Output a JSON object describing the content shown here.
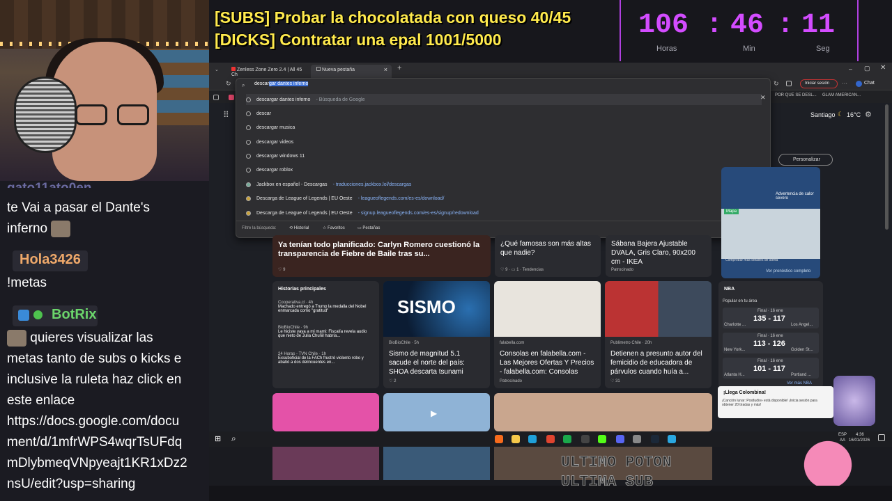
{
  "overlay": {
    "goal_subs": "[SUBS] Probar la chocolatada con queso 40/45",
    "goal_kicks": "[DICKS] Contratar una epal 1001/5000",
    "timer": {
      "hours": "106",
      "minutes": "46",
      "seconds": "11",
      "sep": ":",
      "hours_label": "Horas",
      "minutes_label": "Min",
      "seconds_label": "Seg"
    },
    "accent": "#d34cff",
    "goal_color": "#ffea4d"
  },
  "chat": {
    "partial_user": "gato11ato0en",
    "msg1_line1": "te Vai a pasar el Dante's",
    "msg1_line2": "inferno",
    "user2": "Hola3426",
    "user2_color": "#f0a96a",
    "msg2": "!metas",
    "bot": "BotRix",
    "bot_color": "#6bd56b",
    "bot_lines": [
      "quieres visualizar las",
      "metas tanto de subs o kicks e",
      "inclusive la ruleta haz click en",
      "este enlace",
      "https://docs.google.com/docu",
      "ment/d/1mfrWPS4wqrTsUFdq",
      "mDlybmeqVNpyeajt1KR1xDz2",
      "nsU/edit?usp=sharing"
    ]
  },
  "browser": {
    "tabs": [
      {
        "label": "Zenless Zone Zero 2.4 | All 45 Ch"
      },
      {
        "label": "Nueva pestaña"
      }
    ],
    "address_typed": "descar",
    "address_selected": "gar dantes inferno",
    "signin": "Iniciar sesión",
    "chat": "Chat",
    "fav1": "POR QUE SE DESL...",
    "fav2": "GLAM AMERICAN...",
    "suggestions": [
      {
        "text": "descargar dantes inferno",
        "meta": "- Búsqueda de Google"
      },
      {
        "text": "descar",
        "meta": ""
      },
      {
        "text": "descargar musica",
        "meta": ""
      },
      {
        "text": "descargar videos",
        "meta": ""
      },
      {
        "text": "descargar windows 11",
        "meta": ""
      },
      {
        "text": "descargar roblox",
        "meta": ""
      },
      {
        "text": "Jackbox en español - Descargas",
        "meta": "- traducciones.jackbox.lol/descargas"
      },
      {
        "text": "Descarga de League of Legends | EU Oeste",
        "meta": "- leagueoflegends.com/es-es/download/"
      },
      {
        "text": "Descarga de League of Legends | EU Oeste",
        "meta": "- signup.leagueoflegends.com/es-es/signup/redownload"
      }
    ],
    "filter_label": "Filtre la búsqueda:",
    "filter_history": "Historial",
    "filter_favorites": "Favoritos",
    "filter_tabs": "Pestañas"
  },
  "feed": {
    "weather": {
      "city": "Santiago",
      "temp": "16°C",
      "alert": "Advertencia de calor severo",
      "map": "Mapa",
      "more": "Comprobar más detalles de alerta",
      "forecast": "Ver pronóstico completo",
      "customize": "Personalizar"
    },
    "headline_main": "Ya tenían todo planificado: Carlyn Romero cuestionó la transparencia de Fiebre de Baile tras su...",
    "headline_main_likes": "9",
    "card_famous": "¿Qué famosas son más altas que nadie?",
    "card_famous_likes": "9",
    "card_famous_comments": "1",
    "card_famous_tag": "Tendencias",
    "card_ikea": "Sábana Bajera Ajustable DVALA, Gris Claro, 90x200 cm - IKEA",
    "card_ikea_sponsor": "Patrocinado",
    "top_stories": "Historias principales",
    "stories": [
      {
        "src": "Cooperativa.cl · 4h",
        "text": "Machado entregó a Trump la medalla del Nobel enmarcada como \"gratitud\""
      },
      {
        "src": "BioBioChile · 9h",
        "text": "Le hiciste yaya a mi mami: Fiscalía revela audio que nieto de Julia Chuñil habría..."
      },
      {
        "src": "24 Horas - TVN Chile · 1h",
        "text": "Exsuboficial de la FACh frustró violento robo y abatió a dos delincuentes en..."
      }
    ],
    "sismo_img": "SISMO",
    "sismo_src": "BioBioChile · 5h",
    "sismo_title": "Sismo de magnitud 5.1 sacude el norte del país: SHOA descarta tsunami",
    "sismo_likes": "2",
    "falabella_src": "falabella.com",
    "falabella_title": "Consolas en falabella.com - Las Mejores Ofertas Y Precios - falabella.com: Consolas",
    "falabella_sponsor": "Patrocinado",
    "crime_src": "Publimetro Chile · 20h",
    "crime_title": "Detienen a presunto autor del femicidio de educadora de párvulos cuando huía a...",
    "crime_likes": "31",
    "nba": "NBA",
    "nba_sub": "Popular en tu área",
    "games": [
      {
        "home": "Charlotte ...",
        "away": "Los Angel...",
        "score": "135 - 117",
        "status": "Final · 16 ene"
      },
      {
        "home": "New York...",
        "away": "Golden St...",
        "score": "113 - 126",
        "status": "Final · 16 ene"
      },
      {
        "home": "Atlanta H...",
        "away": "Portland ...",
        "score": "101 - 117",
        "status": "Final · 16 ene"
      }
    ],
    "nba_more": "Ver más NBA",
    "notif_title": "¡Llega Colombina!",
    "notif_text": "¡Canción lunar: Postludio» está disponible! ¡Inicia sesión para obtener 20 tiradas y más!"
  },
  "taskbar": {
    "lang": "ESP",
    "lang2": "AA",
    "time": "4:36",
    "date": "16/01/2026"
  },
  "stream_overlay": {
    "line1": "ULTIMO POTON",
    "line2": "ULTIMA SUB"
  }
}
